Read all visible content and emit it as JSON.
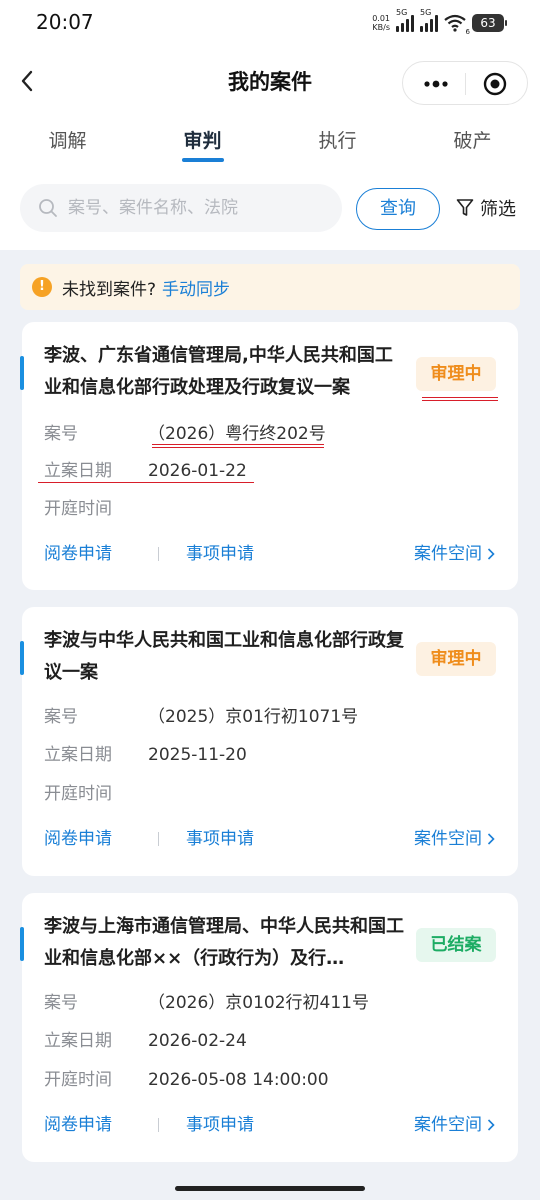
{
  "status_bar": {
    "time": "20:07",
    "net_speed_value": "0.01",
    "net_speed_unit": "KB/s",
    "signal1_label": "5G",
    "signal2_label": "5G",
    "wifi_badge": "6",
    "battery": "63"
  },
  "nav": {
    "title": "我的案件"
  },
  "tabs": [
    {
      "label": "调解",
      "active": false
    },
    {
      "label": "审判",
      "active": true
    },
    {
      "label": "执行",
      "active": false
    },
    {
      "label": "破产",
      "active": false
    }
  ],
  "search": {
    "placeholder": "案号、案件名称、法院",
    "button": "查询",
    "filter": "筛选"
  },
  "notice": {
    "text": "未找到案件?",
    "link": "手动同步"
  },
  "labels": {
    "case_no": "案号",
    "filing_date": "立案日期",
    "hearing_time": "开庭时间",
    "action_read": "阅卷申请",
    "action_matter": "事项申请",
    "action_space": "案件空间"
  },
  "cases": [
    {
      "title": "李波、广东省通信管理局,中华人民共和国工业和信息化部行政处理及行政复议一案",
      "status": "审理中",
      "case_no": "（2026）粤行终202号",
      "filing_date": "2026-01-22",
      "hearing_time": ""
    },
    {
      "title": "李波与中华人民共和国工业和信息化部行政复议一案",
      "status": "审理中",
      "case_no": "（2025）京01行初1071号",
      "filing_date": "2025-11-20",
      "hearing_time": ""
    },
    {
      "title": "李波与上海市通信管理局、中华人民共和国工业和信息化部××（行政行为）及行…",
      "status": "已结案",
      "case_no": "（2026）京0102行初411号",
      "filing_date": "2026-02-24",
      "hearing_time": "2026-05-08 14:00:00"
    }
  ],
  "colors": {
    "accent": "#1a7fd6",
    "pending": "#ef8d1c",
    "closed": "#1dac64",
    "annotation_red": "#d81e2a"
  }
}
